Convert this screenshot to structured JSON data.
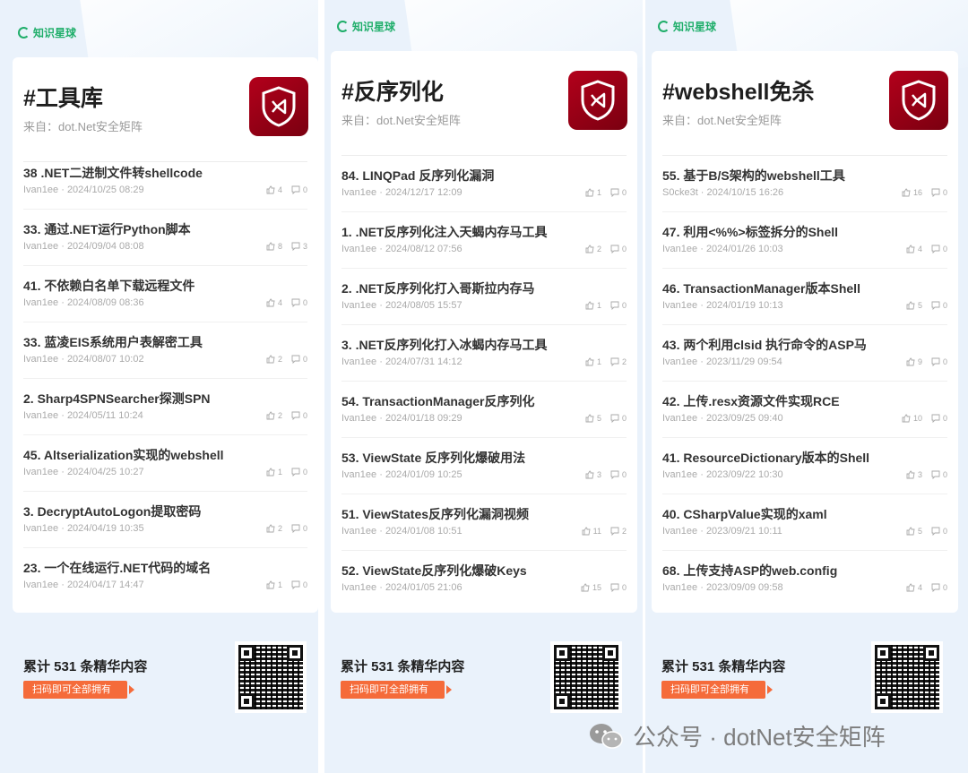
{
  "brand": "知识星球",
  "accent_color": "#1fae6a",
  "cta_color": "#f56b3a",
  "logo_color": "#b3001b",
  "posters": [
    {
      "title": "#工具库",
      "source": "来自：dot.Net安全矩阵",
      "items": [
        {
          "title": "38 .NET二进制文件转shellcode",
          "author": "Ivan1ee",
          "date": "2024/10/25 08:29",
          "likes": "4",
          "comments": "0"
        },
        {
          "title": "33. 通过.NET运行Python脚本",
          "author": "Ivan1ee",
          "date": "2024/09/04 08:08",
          "likes": "8",
          "comments": "3"
        },
        {
          "title": "41. 不依赖白名单下载远程文件",
          "author": "Ivan1ee",
          "date": "2024/08/09 08:36",
          "likes": "4",
          "comments": "0"
        },
        {
          "title": "33. 蓝凌EIS系统用户表解密工具",
          "author": "Ivan1ee",
          "date": "2024/08/07 10:02",
          "likes": "2",
          "comments": "0"
        },
        {
          "title": "2. Sharp4SPNSearcher探测SPN",
          "author": "Ivan1ee",
          "date": "2024/05/11 10:24",
          "likes": "2",
          "comments": "0"
        },
        {
          "title": "45. Altserialization实现的webshell",
          "author": "Ivan1ee",
          "date": "2024/04/25 10:27",
          "likes": "1",
          "comments": "0"
        },
        {
          "title": "3. DecryptAutoLogon提取密码",
          "author": "Ivan1ee",
          "date": "2024/04/19 10:35",
          "likes": "2",
          "comments": "0"
        },
        {
          "title": "23. 一个在线运行.NET代码的域名",
          "author": "Ivan1ee",
          "date": "2024/04/17 14:47",
          "likes": "1",
          "comments": "0"
        }
      ],
      "footer": "累计 531 条精华内容",
      "cta": "扫码即可全部拥有"
    },
    {
      "title": "#反序列化",
      "source": "来自：dot.Net安全矩阵",
      "items": [
        {
          "title": "84. LINQPad 反序列化漏洞",
          "author": "Ivan1ee",
          "date": "2024/12/17 12:09",
          "likes": "1",
          "comments": "0"
        },
        {
          "title": "1. .NET反序列化注入天蝎内存马工具",
          "author": "Ivan1ee",
          "date": "2024/08/12 07:56",
          "likes": "2",
          "comments": "0"
        },
        {
          "title": "2. .NET反序列化打入哥斯拉内存马",
          "author": "Ivan1ee",
          "date": "2024/08/05 15:57",
          "likes": "1",
          "comments": "0"
        },
        {
          "title": "3. .NET反序列化打入冰蝎内存马工具",
          "author": "Ivan1ee",
          "date": "2024/07/31 14:12",
          "likes": "1",
          "comments": "2"
        },
        {
          "title": "54. TransactionManager反序列化",
          "author": "Ivan1ee",
          "date": "2024/01/18 09:29",
          "likes": "5",
          "comments": "0"
        },
        {
          "title": "53. ViewState 反序列化爆破用法",
          "author": "Ivan1ee",
          "date": "2024/01/09 10:25",
          "likes": "3",
          "comments": "0"
        },
        {
          "title": "51. ViewStates反序列化漏洞视频",
          "author": "Ivan1ee",
          "date": "2024/01/08 10:51",
          "likes": "11",
          "comments": "2"
        },
        {
          "title": "52. ViewState反序列化爆破Keys",
          "author": "Ivan1ee",
          "date": "2024/01/05 21:06",
          "likes": "15",
          "comments": "0"
        }
      ],
      "footer": "累计 531 条精华内容",
      "cta": "扫码即可全部拥有"
    },
    {
      "title": "#webshell免杀",
      "source": "来自：dot.Net安全矩阵",
      "items": [
        {
          "title": "55. 基于B/S架构的webshell工具",
          "author": "S0cke3t",
          "date": "2024/10/15 16:26",
          "likes": "16",
          "comments": "0"
        },
        {
          "title": "47. 利用<%%>标签拆分的Shell",
          "author": "Ivan1ee",
          "date": "2024/01/26 10:03",
          "likes": "4",
          "comments": "0"
        },
        {
          "title": "46. TransactionManager版本Shell",
          "author": "Ivan1ee",
          "date": "2024/01/19 10:13",
          "likes": "5",
          "comments": "0"
        },
        {
          "title": "43. 两个利用clsid 执行命令的ASP马",
          "author": "Ivan1ee",
          "date": "2023/11/29 09:54",
          "likes": "9",
          "comments": "0"
        },
        {
          "title": "42. 上传.resx资源文件实现RCE",
          "author": "Ivan1ee",
          "date": "2023/09/25 09:40",
          "likes": "10",
          "comments": "0"
        },
        {
          "title": "41. ResourceDictionary版本的Shell",
          "author": "Ivan1ee",
          "date": "2023/09/22 10:30",
          "likes": "3",
          "comments": "0"
        },
        {
          "title": "40. CSharpValue实现的xaml",
          "author": "Ivan1ee",
          "date": "2023/09/21 10:11",
          "likes": "5",
          "comments": "0"
        },
        {
          "title": "68. 上传支持ASP的web.config",
          "author": "Ivan1ee",
          "date": "2023/09/09 09:58",
          "likes": "4",
          "comments": "0"
        }
      ],
      "footer": "累计 531 条精华内容",
      "cta": "扫码即可全部拥有"
    }
  ],
  "watermark": "公众号 · dotNet安全矩阵"
}
